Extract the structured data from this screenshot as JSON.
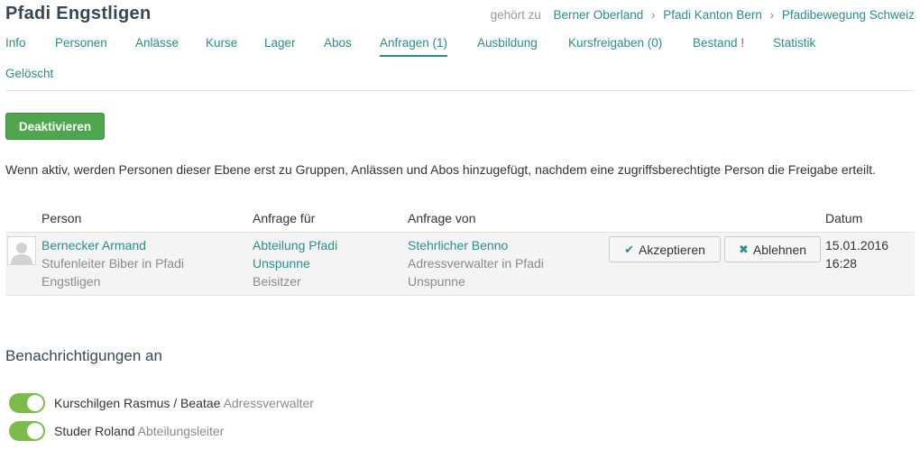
{
  "header": {
    "title": "Pfadi Engstligen",
    "breadcrumb_prefix": "gehört zu",
    "breadcrumbs": [
      "Berner Oberland",
      "Pfadi Kanton Bern",
      "Pfadibewegung Schweiz"
    ]
  },
  "tabs": [
    {
      "label": "Info"
    },
    {
      "label": "Personen"
    },
    {
      "label": "Anlässe"
    },
    {
      "label": "Kurse"
    },
    {
      "label": "Lager"
    },
    {
      "label": "Abos"
    },
    {
      "label": "Anfragen (1)",
      "active": true
    },
    {
      "label": "Ausbildung"
    },
    {
      "label": "Kursfreigaben (0)"
    },
    {
      "label": "Bestand",
      "alert": "!"
    },
    {
      "label": "Statistik"
    },
    {
      "label": "Gelöscht"
    }
  ],
  "actions": {
    "deactivate_label": "Deaktivieren"
  },
  "info_text": "Wenn aktiv, werden Personen dieser Ebene erst zu Gruppen, Anlässen und Abos hinzugefügt, nachdem eine zugriffsberechtigte Person die Freigabe erteilt.",
  "table": {
    "headers": {
      "person": "Person",
      "request_for": "Anfrage für",
      "request_by": "Anfrage von",
      "date": "Datum"
    },
    "rows": [
      {
        "person_name": "Bernecker Armand",
        "person_role_line1": "Stufenleiter Biber in Pfadi",
        "person_role_line2": "Engstligen",
        "for_group_line1": "Abteilung Pfadi",
        "for_group_line2": "Unspunne",
        "for_role": "Beisitzer",
        "by_name": "Stehrlicher Benno",
        "by_role_line1": "Adressverwalter in Pfadi",
        "by_role_line2": "Unspunne",
        "accept_label": "Akzeptieren",
        "reject_label": "Ablehnen",
        "date": "15.01.2016",
        "time": "16:28"
      }
    ]
  },
  "notifications": {
    "title": "Benachrichtigungen an",
    "items": [
      {
        "name": "Kurschilgen Rasmus / Beatae",
        "role": "Adressverwalter",
        "enabled": true
      },
      {
        "name": "Studer Roland",
        "role": "Abteilungsleiter",
        "enabled": true
      }
    ]
  },
  "colors": {
    "accent": "#2a8e8a",
    "button_green": "#4ea64e",
    "toggle_on": "#7cbc4a",
    "alert": "#e0352b"
  }
}
